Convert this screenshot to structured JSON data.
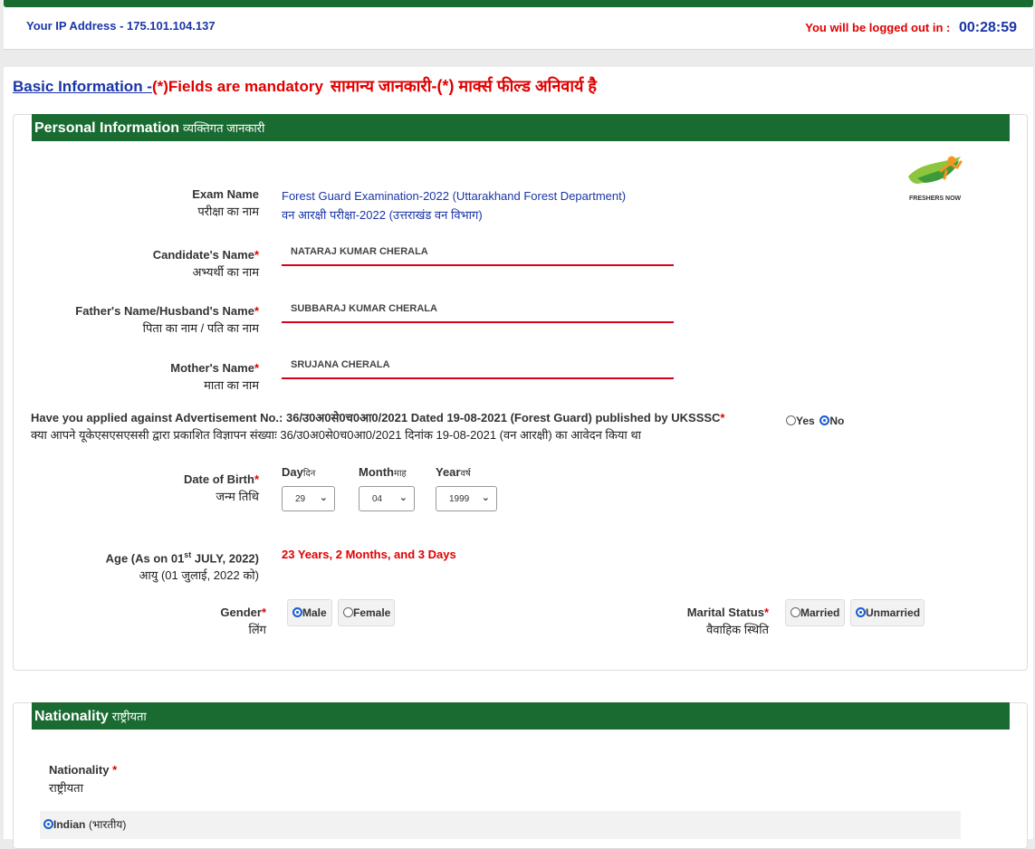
{
  "header": {
    "ip_text": "Your IP Address - 175.101.104.137",
    "logout_label": "You will be logged out in :",
    "timer": "00:28:59"
  },
  "basic": {
    "link": "Basic Information -",
    "mandatory": "(*)Fields are mandatory",
    "hindi": "सामान्य जानकारी-(*) मार्क्स फील्ड अनिवार्य है"
  },
  "personal": {
    "title": "Personal Information",
    "title_hi": "व्यक्तिगत जानकारी",
    "logo_text": "FRESHERS NOW",
    "exam_label": "Exam Name",
    "exam_label_hi": "परीक्षा का नाम",
    "exam_value": "Forest Guard Examination-2022 (Uttarakhand Forest Department)",
    "exam_value_hi": "वन आरक्षी परीक्षा-2022 (उत्तराखंड वन विभाग)",
    "candidate_label": "Candidate's Name",
    "candidate_label_hi": "अभ्यर्थी का नाम",
    "candidate_value": "NATARAJ KUMAR CHERALA",
    "father_label": "Father's Name/Husband's Name",
    "father_label_hi": "पिता का नाम / पति का नाम",
    "father_value": "SUBBARAJ KUMAR CHERALA",
    "mother_label": "Mother's Name",
    "mother_label_hi": "माता का नाम",
    "mother_value": "SRUJANA CHERALA",
    "question": "Have you applied against Advertisement No.: 36/उ0अ0से0च0आ0/2021 Dated 19-08-2021 (Forest Guard) published by UKSSSC",
    "question_hi": "क्या आपने यूकेएसएसएससी द्वारा प्रकाशित विज्ञापन संख्याः 36/उ0अ0से0च0आ0/2021 दिनांक 19-08-2021 (वन आरक्षी) का आवेदन किया था",
    "yes": "Yes",
    "no": "No",
    "dob_label": "Date of Birth",
    "dob_label_hi": "जन्म तिथि",
    "day_label": "Day",
    "day_label_hi": "दिन",
    "month_label": "Month",
    "month_label_hi": "माह",
    "year_label": "Year",
    "year_label_hi": "वर्ष",
    "day_value": "29",
    "month_value": "04",
    "year_value": "1999",
    "age_label_a": "Age (As on 01",
    "age_label_sup": "st",
    "age_label_b": " JULY, 2022)",
    "age_label_hi": "आयु (01 जुलाई, 2022 को)",
    "age_value": "23 Years, 2 Months, and 3 Days",
    "gender_label": "Gender",
    "gender_label_hi": "लिंग",
    "male": "Male",
    "female": "Female",
    "marital_label": "Marital Status",
    "marital_label_hi": "वैवाहिक स्थिति",
    "married": "Married",
    "unmarried": "Unmarried",
    "required_mark": "*"
  },
  "nationality": {
    "title": "Nationality",
    "title_hi": "राष्ट्रीयता",
    "label": "Nationality",
    "label_hi": "राष्ट्रीयता",
    "option": "Indian",
    "option_hi": "(भारतीय)",
    "required_mark": "*"
  },
  "colors": {
    "green": "#1a6b32",
    "red": "#e00000",
    "blue": "#1a35a8",
    "radio_selected": "#1a5fd6"
  }
}
